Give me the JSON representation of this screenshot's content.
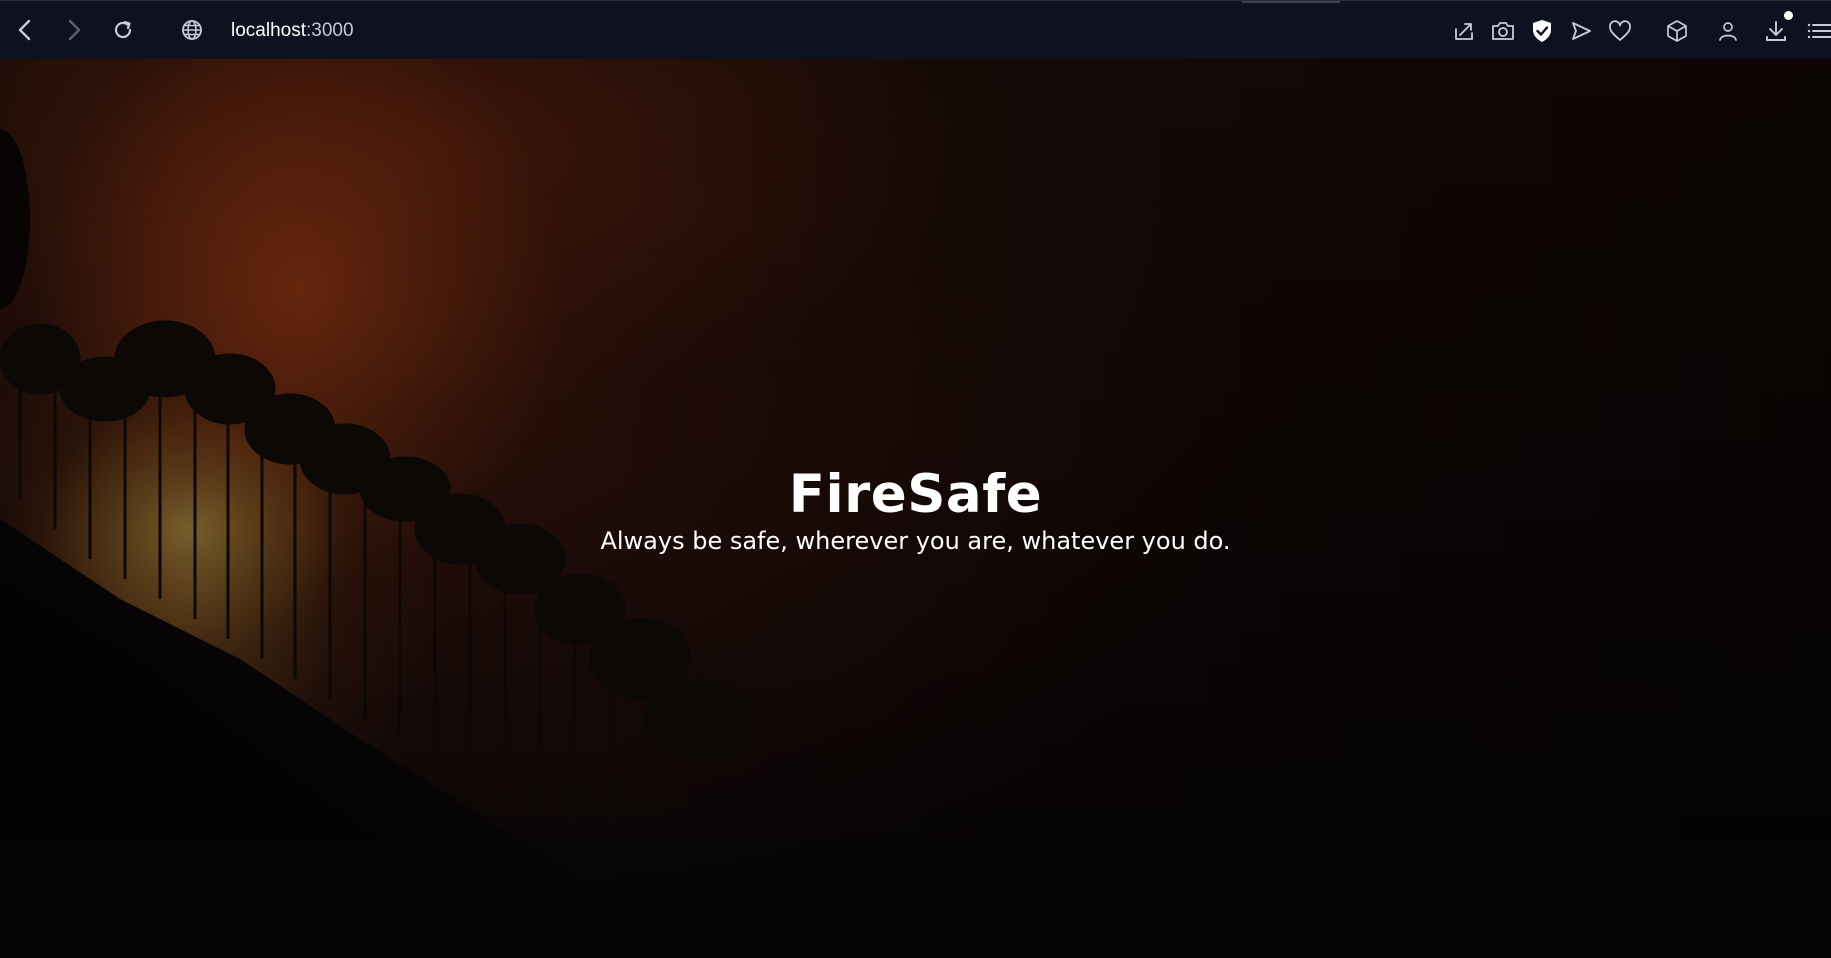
{
  "browser": {
    "address_host": "localhost",
    "address_port": ":3000",
    "icons": [
      "back-icon",
      "forward-icon",
      "reload-icon",
      "site-info-icon",
      "share-icon",
      "camera-icon",
      "shield-icon",
      "send-icon",
      "heart-icon",
      "cube-icon",
      "profile-icon",
      "download-icon",
      "menu-icon"
    ]
  },
  "hero": {
    "title": "FireSafe",
    "tagline": "Always be safe, wherever you are, whatever you do."
  },
  "colors": {
    "toolbar_bg": "#0e1220",
    "text": "#ffffff",
    "fire_glow": "#7a2d10"
  }
}
